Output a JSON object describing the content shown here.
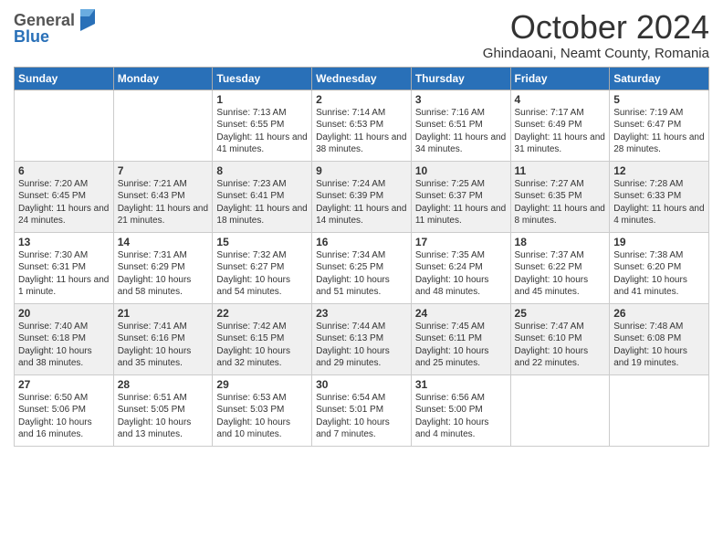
{
  "header": {
    "logo_line1": "General",
    "logo_line2": "Blue",
    "month": "October 2024",
    "location": "Ghindaoani, Neamt County, Romania"
  },
  "days_of_week": [
    "Sunday",
    "Monday",
    "Tuesday",
    "Wednesday",
    "Thursday",
    "Friday",
    "Saturday"
  ],
  "weeks": [
    [
      {
        "day": "",
        "info": ""
      },
      {
        "day": "",
        "info": ""
      },
      {
        "day": "1",
        "info": "Sunrise: 7:13 AM\nSunset: 6:55 PM\nDaylight: 11 hours and 41 minutes."
      },
      {
        "day": "2",
        "info": "Sunrise: 7:14 AM\nSunset: 6:53 PM\nDaylight: 11 hours and 38 minutes."
      },
      {
        "day": "3",
        "info": "Sunrise: 7:16 AM\nSunset: 6:51 PM\nDaylight: 11 hours and 34 minutes."
      },
      {
        "day": "4",
        "info": "Sunrise: 7:17 AM\nSunset: 6:49 PM\nDaylight: 11 hours and 31 minutes."
      },
      {
        "day": "5",
        "info": "Sunrise: 7:19 AM\nSunset: 6:47 PM\nDaylight: 11 hours and 28 minutes."
      }
    ],
    [
      {
        "day": "6",
        "info": "Sunrise: 7:20 AM\nSunset: 6:45 PM\nDaylight: 11 hours and 24 minutes."
      },
      {
        "day": "7",
        "info": "Sunrise: 7:21 AM\nSunset: 6:43 PM\nDaylight: 11 hours and 21 minutes."
      },
      {
        "day": "8",
        "info": "Sunrise: 7:23 AM\nSunset: 6:41 PM\nDaylight: 11 hours and 18 minutes."
      },
      {
        "day": "9",
        "info": "Sunrise: 7:24 AM\nSunset: 6:39 PM\nDaylight: 11 hours and 14 minutes."
      },
      {
        "day": "10",
        "info": "Sunrise: 7:25 AM\nSunset: 6:37 PM\nDaylight: 11 hours and 11 minutes."
      },
      {
        "day": "11",
        "info": "Sunrise: 7:27 AM\nSunset: 6:35 PM\nDaylight: 11 hours and 8 minutes."
      },
      {
        "day": "12",
        "info": "Sunrise: 7:28 AM\nSunset: 6:33 PM\nDaylight: 11 hours and 4 minutes."
      }
    ],
    [
      {
        "day": "13",
        "info": "Sunrise: 7:30 AM\nSunset: 6:31 PM\nDaylight: 11 hours and 1 minute."
      },
      {
        "day": "14",
        "info": "Sunrise: 7:31 AM\nSunset: 6:29 PM\nDaylight: 10 hours and 58 minutes."
      },
      {
        "day": "15",
        "info": "Sunrise: 7:32 AM\nSunset: 6:27 PM\nDaylight: 10 hours and 54 minutes."
      },
      {
        "day": "16",
        "info": "Sunrise: 7:34 AM\nSunset: 6:25 PM\nDaylight: 10 hours and 51 minutes."
      },
      {
        "day": "17",
        "info": "Sunrise: 7:35 AM\nSunset: 6:24 PM\nDaylight: 10 hours and 48 minutes."
      },
      {
        "day": "18",
        "info": "Sunrise: 7:37 AM\nSunset: 6:22 PM\nDaylight: 10 hours and 45 minutes."
      },
      {
        "day": "19",
        "info": "Sunrise: 7:38 AM\nSunset: 6:20 PM\nDaylight: 10 hours and 41 minutes."
      }
    ],
    [
      {
        "day": "20",
        "info": "Sunrise: 7:40 AM\nSunset: 6:18 PM\nDaylight: 10 hours and 38 minutes."
      },
      {
        "day": "21",
        "info": "Sunrise: 7:41 AM\nSunset: 6:16 PM\nDaylight: 10 hours and 35 minutes."
      },
      {
        "day": "22",
        "info": "Sunrise: 7:42 AM\nSunset: 6:15 PM\nDaylight: 10 hours and 32 minutes."
      },
      {
        "day": "23",
        "info": "Sunrise: 7:44 AM\nSunset: 6:13 PM\nDaylight: 10 hours and 29 minutes."
      },
      {
        "day": "24",
        "info": "Sunrise: 7:45 AM\nSunset: 6:11 PM\nDaylight: 10 hours and 25 minutes."
      },
      {
        "day": "25",
        "info": "Sunrise: 7:47 AM\nSunset: 6:10 PM\nDaylight: 10 hours and 22 minutes."
      },
      {
        "day": "26",
        "info": "Sunrise: 7:48 AM\nSunset: 6:08 PM\nDaylight: 10 hours and 19 minutes."
      }
    ],
    [
      {
        "day": "27",
        "info": "Sunrise: 6:50 AM\nSunset: 5:06 PM\nDaylight: 10 hours and 16 minutes."
      },
      {
        "day": "28",
        "info": "Sunrise: 6:51 AM\nSunset: 5:05 PM\nDaylight: 10 hours and 13 minutes."
      },
      {
        "day": "29",
        "info": "Sunrise: 6:53 AM\nSunset: 5:03 PM\nDaylight: 10 hours and 10 minutes."
      },
      {
        "day": "30",
        "info": "Sunrise: 6:54 AM\nSunset: 5:01 PM\nDaylight: 10 hours and 7 minutes."
      },
      {
        "day": "31",
        "info": "Sunrise: 6:56 AM\nSunset: 5:00 PM\nDaylight: 10 hours and 4 minutes."
      },
      {
        "day": "",
        "info": ""
      },
      {
        "day": "",
        "info": ""
      }
    ]
  ]
}
